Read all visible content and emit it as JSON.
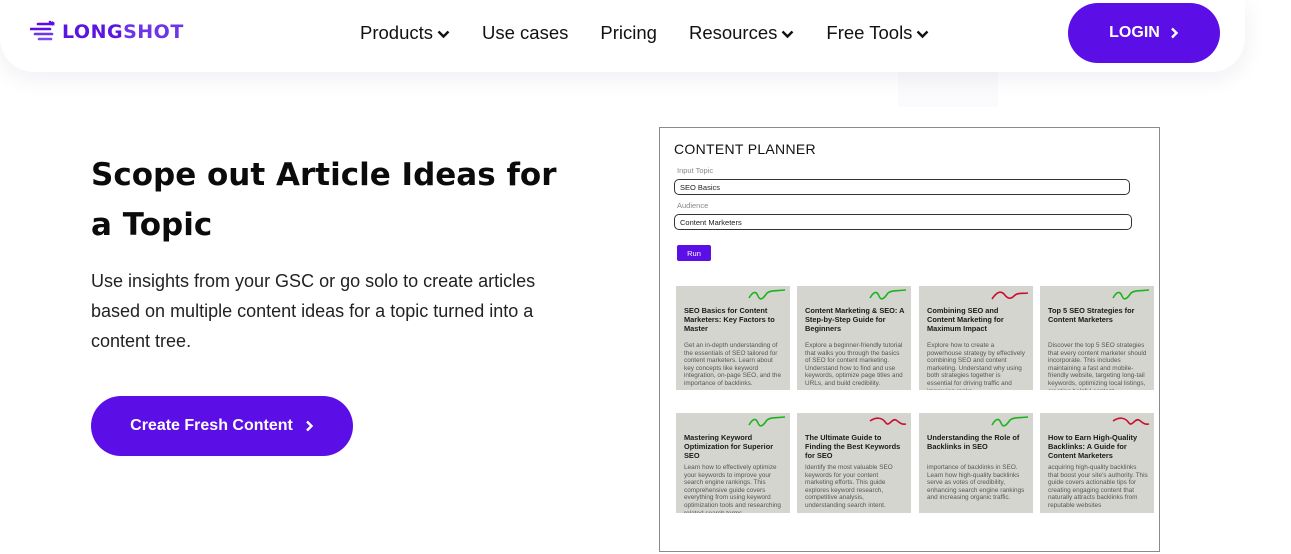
{
  "header": {
    "logo": {
      "part1": "LONG",
      "part2": "SHOT"
    },
    "nav": [
      {
        "label": "Products",
        "dropdown": true
      },
      {
        "label": "Use cases",
        "dropdown": false
      },
      {
        "label": "Pricing",
        "dropdown": false
      },
      {
        "label": "Resources",
        "dropdown": true
      },
      {
        "label": "Free Tools",
        "dropdown": true
      }
    ],
    "login_label": "LOGIN"
  },
  "hero": {
    "title": "Scope out Article Ideas for a Topic",
    "text": "Use insights from your GSC or go solo to create articles based on multiple content ideas for a topic turned into a content tree.",
    "cta_label": "Create Fresh Content"
  },
  "planner": {
    "title": "CONTENT PLANNER",
    "topic_label": "Input Topic",
    "topic_value": "SEO Basics",
    "audience_label": "Audience",
    "audience_value": "Content Marketers",
    "run_label": "Run",
    "cards": [
      {
        "title": "SEO Basics for Content Marketers: Key Factors to Master",
        "body": "Get an in-depth understanding of the essentials of SEO tailored for content marketers. Learn about key concepts like keyword integration, on-page SEO, and the importance of backlinks.",
        "trend": "green"
      },
      {
        "title": "Content Marketing & SEO: A Step-by-Step Guide for Beginners",
        "body": "Explore a beginner-friendly tutorial that walks you through the basics of SEO for content marketing. Understand how to find and use keywords, optimize page titles and URLs, and build credibility.",
        "trend": "green"
      },
      {
        "title": "Combining SEO and Content Marketing for Maximum Impact",
        "body": "Explore how to create a powerhouse strategy by effectively combining SEO and content marketing. Understand why using both strategies together is essential for driving traffic and improving ranks.",
        "trend": "red"
      },
      {
        "title": "Top 5 SEO Strategies for Content Marketers",
        "body": "Discover the top 5 SEO strategies that every content marketer should incorporate. This includes maintaining a fast and mobile-friendly website, targeting long-tail keywords, optimizing local listings, creating helpful content.",
        "trend": "green"
      },
      {
        "title": "Mastering Keyword Optimization for Superior SEO",
        "body": "Learn how to effectively optimize your keywords to improve your search engine rankings. This comprehensive guide covers everything from using keyword optimization tools and researching related search terms.",
        "trend": "green"
      },
      {
        "title": "The Ultimate Guide to Finding the Best Keywords for SEO",
        "body": "Identify the most valuable SEO keywords for your content marketing efforts. This guide explores keyword research, competitive analysis, understanding search intent.",
        "trend": "red"
      },
      {
        "title": "Understanding the Role of Backlinks in SEO",
        "body": "importance of backlinks in SEO. Learn how high-quality backlinks serve as votes of credibility, enhancing search engine rankings and increasing organic traffic.",
        "trend": "green"
      },
      {
        "title": "How to Earn High-Quality Backlinks: A Guide for Content Marketers",
        "body": "acquiring high-quality backlinks that boost your site's authority. This guide covers actionable tips for creating engaging content that naturally attracts backlinks from reputable websites",
        "trend": "red"
      }
    ]
  },
  "colors": {
    "brand": "#5b0ee6",
    "trend_up": "#1db31d",
    "trend_down": "#c8102e",
    "card_bg": "#d5d5d0"
  },
  "icons": {
    "logo": "speed-lines-logo-icon",
    "dropdown": "chevron-down-icon",
    "button": "chevron-right-icon"
  }
}
